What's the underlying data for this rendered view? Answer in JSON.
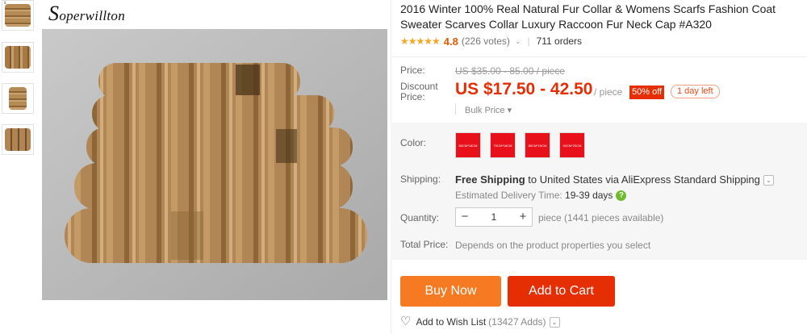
{
  "brand": {
    "logo_text": "Soperwillton",
    "logo_cap": "S",
    "logo_rest": "operwillton"
  },
  "product": {
    "title": "2016 Winter 100% Real Natural Fur Collar & Womens Scarfs Fashion Coat Sweater Scarves Collar Luxury Raccoon Fur Neck Cap #A320",
    "rating_value": "4.8",
    "votes": "(226 votes)",
    "orders": "711 orders",
    "stars": "★★★★★"
  },
  "price": {
    "price_label": "Price:",
    "original": "US $35.00 - 85.00 / piece",
    "discount_label_1": "Discount",
    "discount_label_2": "Price:",
    "discount": "US $17.50 - 42.50",
    "unit": "/ piece",
    "off_badge": "50% off",
    "days_left": "1 day left",
    "bulk_price": "Bulk Price"
  },
  "options": {
    "color_label": "Color:",
    "colors": [
      "80CM*18CM",
      "70CM*18CM",
      "80CM*19CM",
      "90CM*23CM"
    ],
    "swatch_color": "#e8101a",
    "shipping_label": "Shipping:",
    "shipping_free": "Free Shipping",
    "shipping_rest": " to United States via AliExpress Standard Shipping",
    "delivery_prefix": "Estimated Delivery Time: ",
    "delivery_days": "19-39 days",
    "quantity_label": "Quantity:",
    "quantity_value": "1",
    "pieces_available": "piece (1441 pieces available)",
    "total_label": "Total Price:",
    "total_value": "Depends on the product properties you select"
  },
  "actions": {
    "buy_now": "Buy Now",
    "add_to_cart": "Add to Cart",
    "wish_list": "Add to Wish List",
    "wish_adds": "(13427 Adds)"
  },
  "colors": {
    "accent_red": "#e62e04",
    "buy_orange": "#f57a21",
    "star": "#f5a623",
    "rating": "#e45900"
  }
}
